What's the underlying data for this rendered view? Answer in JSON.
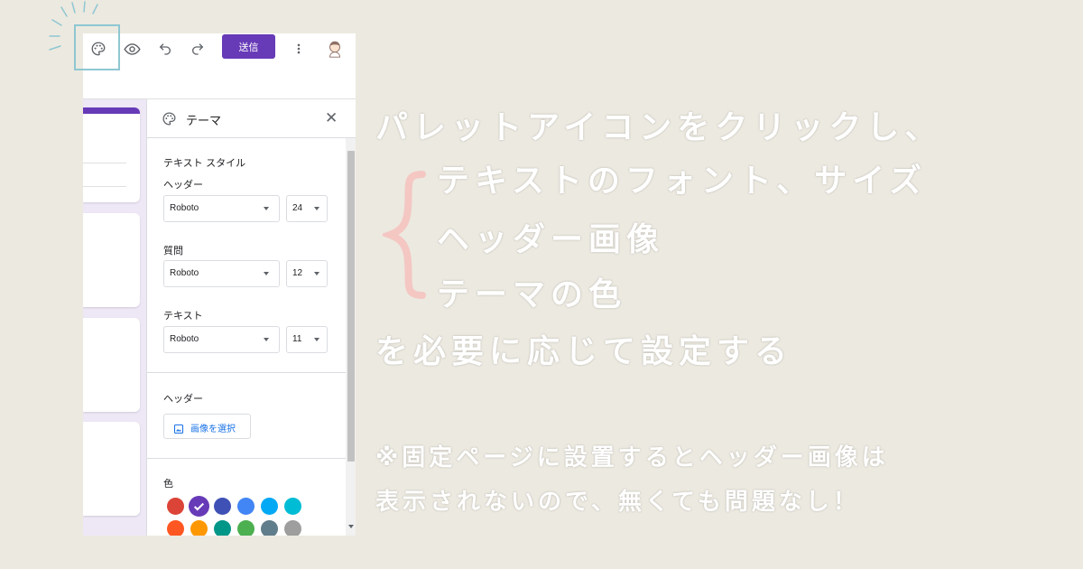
{
  "toolbar": {
    "send_label": "送信",
    "icons": [
      "palette-icon",
      "eye-icon",
      "undo-icon",
      "redo-icon",
      "more-vert-icon",
      "avatar"
    ]
  },
  "theme_panel": {
    "title": "テーマ",
    "text_style_heading": "テキスト スタイル",
    "header_label": "ヘッダー",
    "header_font": "Roboto",
    "header_size": "24",
    "question_label": "質問",
    "question_font": "Roboto",
    "question_size": "12",
    "text_label": "テキスト",
    "text_font": "Roboto",
    "text_size": "11",
    "header_section_label": "ヘッダー",
    "select_image_label": "画像を選択",
    "color_label": "色",
    "colors_row1": [
      "#db4437",
      "#673ab7",
      "#3f51b5",
      "#4285f4",
      "#03a9f4",
      "#00bcd4"
    ],
    "colors_row2": [
      "#ff5722",
      "#ff9800",
      "#009688",
      "#4caf50",
      "#607d8b",
      "#9e9e9e"
    ],
    "selected_color": "#673ab7"
  },
  "annotation": {
    "line1": "パレットアイコンをクリックし、",
    "line2": "テキストのフォント、サイズ",
    "line3": "ヘッダー画像",
    "line4": "テーマの色",
    "line5": "を必要に応じて設定する",
    "note1": "※固定ページに設置するとヘッダー画像は",
    "note2": "表示されないので、無くても問題なし！",
    "brace_color": "#f4c7c3",
    "highlight_color": "#8ec7d2"
  }
}
